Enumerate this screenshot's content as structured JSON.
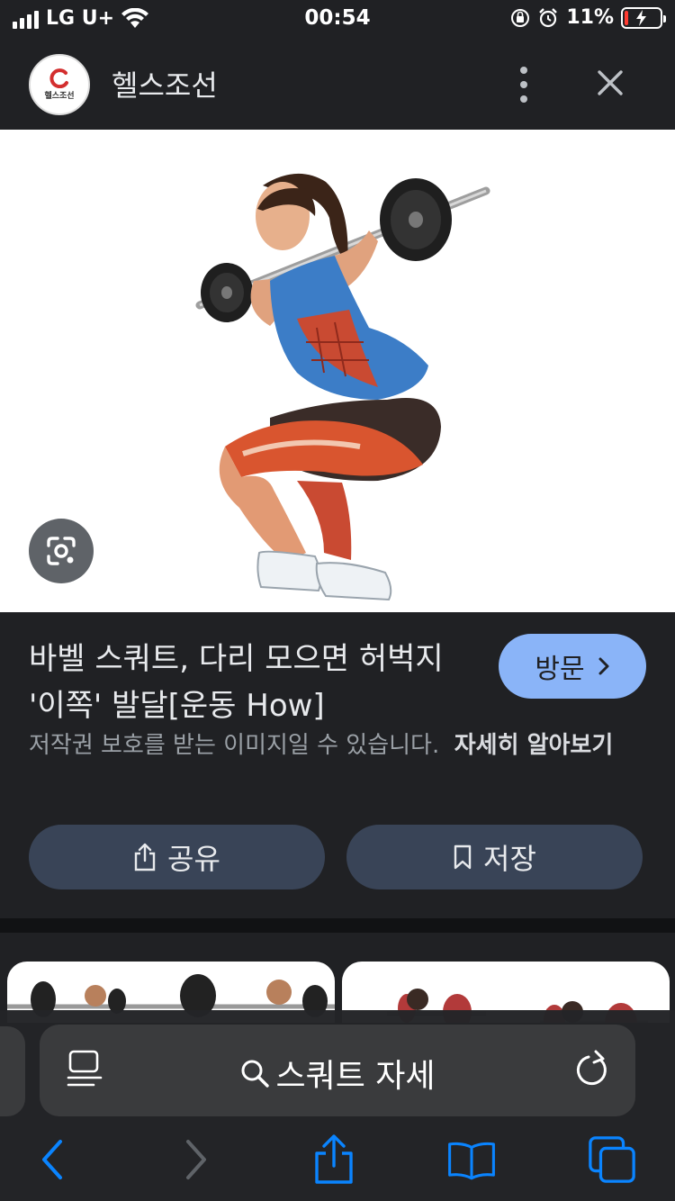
{
  "status_bar": {
    "carrier": "LG U+",
    "time": "00:54",
    "battery_percent": "11%",
    "battery_level": 0.11,
    "colors": {
      "battery_low": "#ff3b30"
    }
  },
  "header": {
    "site_name": "헬스조선",
    "logo_text": "헬스조선",
    "logo_icon": "health-chosun-logo"
  },
  "result": {
    "title": "바벨 스쿼트, 다리 모으면 허벅지 '이쪽' 발달[운동 How]",
    "visit_label": "방문",
    "copyright_notice": "저작권 보호를 받는 이미지일 수 있습니다.",
    "learn_more": "자세히 알아보기",
    "share_label": "공유",
    "save_label": "저장",
    "colors": {
      "visit_button": "#8ab4f8",
      "action_button": "#394457"
    }
  },
  "address_bar": {
    "query": "스쿼트 자세"
  },
  "toolbar": {
    "icons": [
      "back-icon",
      "forward-icon",
      "share-icon",
      "bookmarks-icon",
      "tabs-icon"
    ],
    "colors": {
      "active": "#0a84ff",
      "disabled": "#5f6368"
    }
  }
}
